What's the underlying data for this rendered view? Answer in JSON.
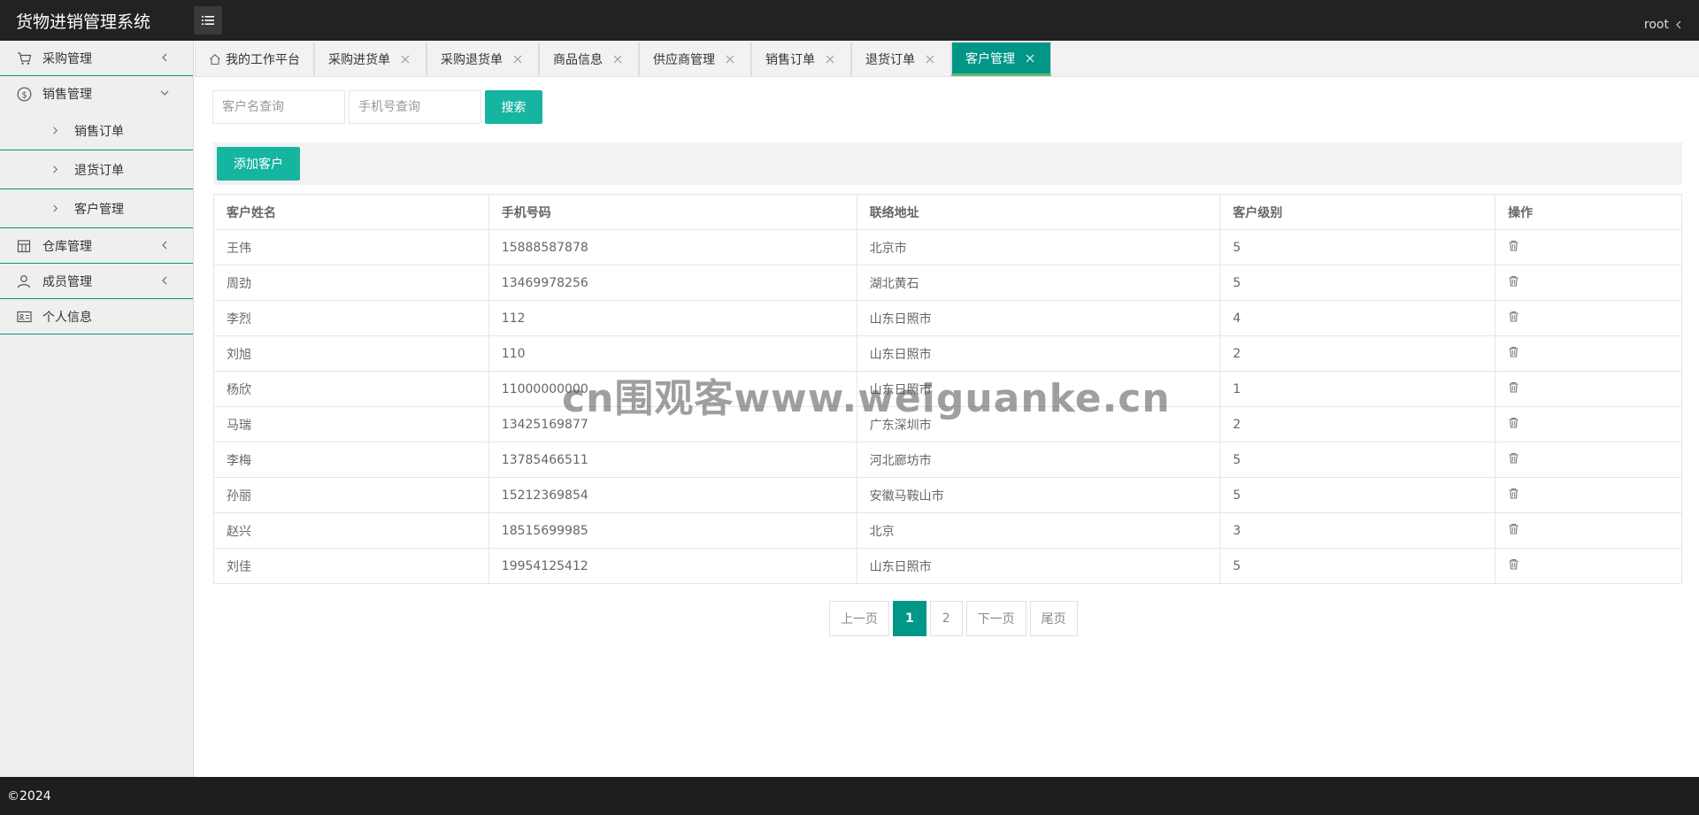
{
  "app": {
    "title": "货物进销管理系统",
    "user": "root",
    "footer": "©2024"
  },
  "sidebar": {
    "items": [
      {
        "label": "采购管理",
        "icon": "cart-icon"
      },
      {
        "label": "销售管理",
        "icon": "dollar-circle-icon"
      },
      {
        "label": "仓库管理",
        "icon": "warehouse-icon"
      },
      {
        "label": "成员管理",
        "icon": "user-icon"
      },
      {
        "label": "个人信息",
        "icon": "id-card-icon"
      }
    ],
    "sub_items": [
      {
        "label": "销售订单"
      },
      {
        "label": "退货订单"
      },
      {
        "label": "客户管理"
      }
    ]
  },
  "tabs": [
    {
      "label": "我的工作平台"
    },
    {
      "label": "采购进货单"
    },
    {
      "label": "采购退货单"
    },
    {
      "label": "商品信息"
    },
    {
      "label": "供应商管理"
    },
    {
      "label": "销售订单"
    },
    {
      "label": "退货订单"
    },
    {
      "label": "客户管理"
    }
  ],
  "search": {
    "name_placeholder": "客户名查询",
    "phone_placeholder": "手机号查询",
    "button": "搜索"
  },
  "toolbar": {
    "add_button": "添加客户"
  },
  "table": {
    "headers": [
      "客户姓名",
      "手机号码",
      "联络地址",
      "客户级别",
      "操作"
    ],
    "rows": [
      {
        "name": "王伟",
        "phone": "15888587878",
        "address": "北京市",
        "level": "5"
      },
      {
        "name": "周劲",
        "phone": "13469978256",
        "address": "湖北黄石",
        "level": "5"
      },
      {
        "name": "李烈",
        "phone": "112",
        "address": "山东日照市",
        "level": "4"
      },
      {
        "name": "刘旭",
        "phone": "110",
        "address": "山东日照市",
        "level": "2"
      },
      {
        "name": "杨欣",
        "phone": "11000000000",
        "address": "山东日照市",
        "level": "1"
      },
      {
        "name": "马瑞",
        "phone": "13425169877",
        "address": "广东深圳市",
        "level": "2"
      },
      {
        "name": "李梅",
        "phone": "13785466511",
        "address": "河北廊坊市",
        "level": "5"
      },
      {
        "name": "孙丽",
        "phone": "15212369854",
        "address": "安徽马鞍山市",
        "level": "5"
      },
      {
        "name": "赵兴",
        "phone": "18515699985",
        "address": "北京",
        "level": "3"
      },
      {
        "name": "刘佳",
        "phone": "19954125412",
        "address": "山东日照市",
        "level": "5"
      }
    ]
  },
  "pagination": {
    "prev": "上一页",
    "pages": [
      "1",
      "2"
    ],
    "current": "1",
    "next": "下一页",
    "last": "尾页"
  },
  "watermark": "cn围观客www.weiguanke.cn",
  "colors": {
    "accent": "#009688",
    "button": "#16b5a0",
    "header": "#222222",
    "footer": "#1e1e1e"
  }
}
